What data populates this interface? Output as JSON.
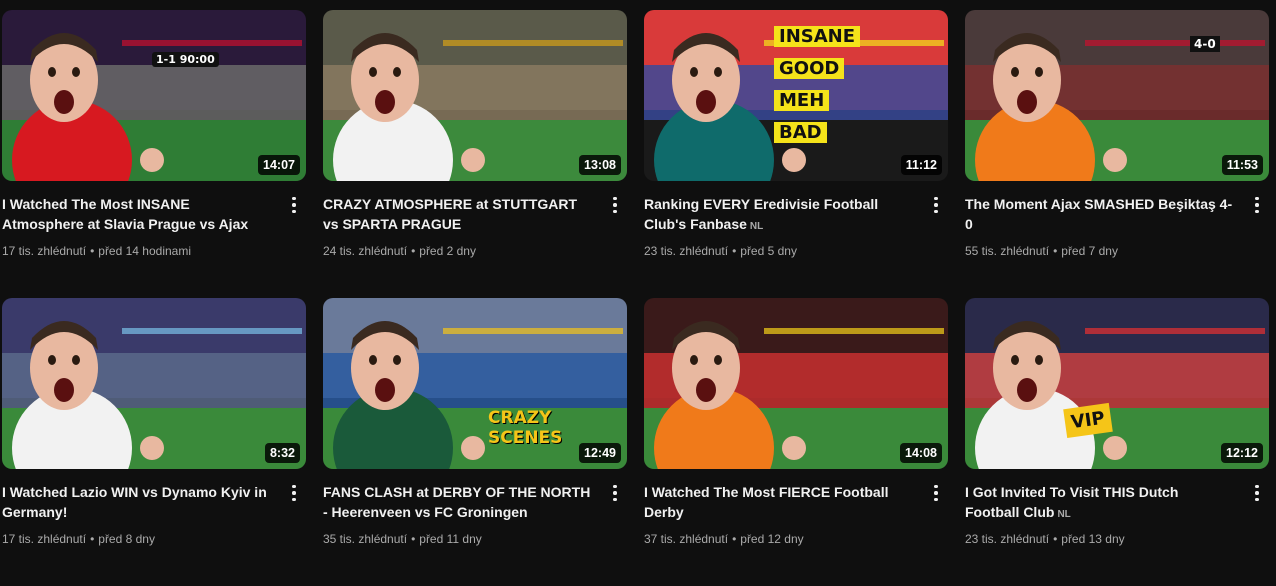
{
  "videos": [
    {
      "title": "I Watched The Most INSANE Atmosphere at Slavia Prague vs Ajax",
      "badge": "",
      "views": "17 tis. zhlédnutí",
      "age": "před 14 hodinami",
      "duration": "14:07",
      "thumb": {
        "sky": "#2a1a3a",
        "field": "#2f7d35",
        "accent": "#c8102e",
        "shirt": "#d71920",
        "crowd": "#6a6a6a"
      }
    },
    {
      "title": "CRAZY ATMOSPHERE at STUTTGART vs SPARTA PRAGUE",
      "badge": "",
      "views": "24 tis. zhlédnutí",
      "age": "před 2 dny",
      "duration": "13:08",
      "thumb": {
        "sky": "#5a5a4a",
        "field": "#3c8a3c",
        "accent": "#d4a017",
        "shirt": "#f2f2f2",
        "crowd": "#8a7a60"
      }
    },
    {
      "title": "Ranking EVERY Eredivisie Football Club's Fanbase",
      "badge": "NL",
      "views": "23 tis. zhlédnutí",
      "age": "před 5 dny",
      "duration": "11:12",
      "thumb": {
        "sky": "#d93a3a",
        "field": "#1a1a1a",
        "accent": "#f5e31a",
        "shirt": "#0f6b6b",
        "crowd": "#3a4a9a"
      }
    },
    {
      "title": "The Moment Ajax SMASHED Beşiktaş 4-0",
      "badge": "",
      "views": "55 tis. zhlédnutí",
      "age": "před 7 dny",
      "duration": "11:53",
      "thumb": {
        "sky": "#4a3a3a",
        "field": "#3a8a3a",
        "accent": "#c8102e",
        "shirt": "#f07a1a",
        "crowd": "#7a3030"
      }
    },
    {
      "title": "I Watched Lazio WIN vs Dynamo Kyiv in Germany!",
      "badge": "",
      "views": "17 tis. zhlédnutí",
      "age": "před 8 dny",
      "duration": "8:32",
      "thumb": {
        "sky": "#3a3a6a",
        "field": "#3a8a3a",
        "accent": "#7ac0e8",
        "shirt": "#f2f2f2",
        "crowd": "#5a6a8a"
      }
    },
    {
      "title": "FANS CLASH at DERBY OF THE NORTH - Heerenveen vs FC Groningen",
      "badge": "",
      "views": "35 tis. zhlédnutí",
      "age": "před 11 dny",
      "duration": "12:49",
      "thumb": {
        "sky": "#6a7a9a",
        "field": "#3a8a3a",
        "accent": "#f5c518",
        "shirt": "#1a5a3a",
        "crowd": "#2a5aa0"
      }
    },
    {
      "title": "I Watched The Most FIERCE Football Derby",
      "badge": "",
      "views": "37 tis. zhlédnutí",
      "age": "před 12 dny",
      "duration": "14:08",
      "thumb": {
        "sky": "#3a1a1a",
        "field": "#3a8a3a",
        "accent": "#f5d21a",
        "shirt": "#f07a1a",
        "crowd": "#c83030"
      }
    },
    {
      "title": "I Got Invited To Visit THIS Dutch Football Club",
      "badge": "NL",
      "views": "23 tis. zhlédnutí",
      "age": "před 13 dny",
      "duration": "12:12",
      "thumb": {
        "sky": "#2a2a4a",
        "field": "#3a8a3a",
        "accent": "#e83030",
        "shirt": "#f2f2f2",
        "crowd": "#c84040"
      }
    }
  ],
  "overlays": {
    "v1_score": "1-1 90:00",
    "v3_tiers": [
      "INSANE",
      "GOOD",
      "MEH",
      "BAD"
    ],
    "v4_score": "4-0",
    "v6_caption": [
      "CRAZY",
      "SCENES"
    ],
    "v8_sign": "VIP"
  }
}
